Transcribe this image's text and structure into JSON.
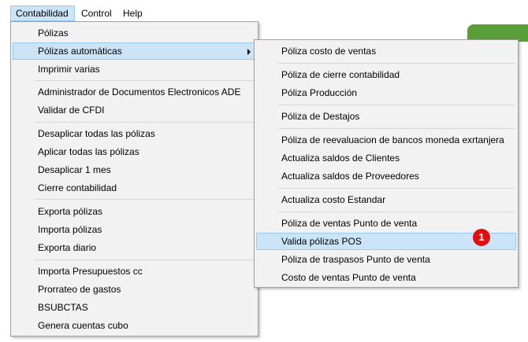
{
  "menubar": {
    "items": [
      {
        "label": "Contabilidad"
      },
      {
        "label": "Control"
      },
      {
        "label": "Help"
      }
    ]
  },
  "main_menu": {
    "items": [
      "Pólizas",
      "Pólizas automáticas",
      "Imprimir varias",
      "Administrador de Documentos Electronicos ADE",
      "Validar de CFDI",
      "Desaplicar todas las pólizas",
      "Aplicar todas las pólizas",
      "Desaplicar  1 mes",
      "Cierre contabilidad",
      "Exporta pólizas",
      "Importa pólizas",
      "Exporta diario",
      "Importa Presupuestos cc",
      "Prorrateo de gastos",
      "BSUBCTAS",
      "Genera cuentas cubo"
    ]
  },
  "submenu": {
    "items": [
      "Póliza costo de ventas",
      "Póliza de cierre contabilidad",
      "Póliza Producción",
      "Póliza de Destajos",
      "Póliza de reevaluacion de bancos moneda exrtanjera",
      "Actualiza saldos de Clientes",
      "Actualiza saldos de Proveedores",
      "Actualiza costo Estandar",
      "Póliza de ventas Punto de venta",
      "Valida pólizas POS",
      "Póliza de traspasos Punto de venta",
      "Costo de ventas Punto de venta"
    ]
  },
  "callout": {
    "number": "1",
    "color": "#e01010"
  },
  "colors": {
    "highlight": "#cce4f7",
    "menu_bg": "#f2f2f2",
    "accent_green": "#5a9e3a"
  }
}
